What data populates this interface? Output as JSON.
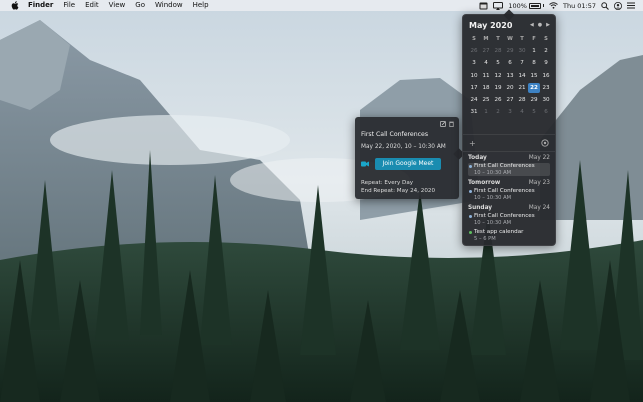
{
  "menubar": {
    "app_name": "Finder",
    "menus": [
      "File",
      "Edit",
      "View",
      "Go",
      "Window",
      "Help"
    ],
    "battery_percent": "100%",
    "clock": "Thu 01:57",
    "icons": [
      "apple-icon",
      "calendar-status-icon",
      "airplay-icon",
      "battery-icon",
      "wifi-icon",
      "search-icon",
      "user-icon",
      "list-icon"
    ]
  },
  "calendar": {
    "month_title": "May 2020",
    "weekdays": [
      "S",
      "M",
      "T",
      "W",
      "T",
      "F",
      "S"
    ],
    "weeks": [
      [
        {
          "d": "26",
          "dim": true
        },
        {
          "d": "27",
          "dim": true
        },
        {
          "d": "28",
          "dim": true
        },
        {
          "d": "29",
          "dim": true
        },
        {
          "d": "30",
          "dim": true
        },
        {
          "d": "1"
        },
        {
          "d": "2"
        }
      ],
      [
        {
          "d": "3"
        },
        {
          "d": "4"
        },
        {
          "d": "5"
        },
        {
          "d": "6"
        },
        {
          "d": "7"
        },
        {
          "d": "8"
        },
        {
          "d": "9"
        }
      ],
      [
        {
          "d": "10"
        },
        {
          "d": "11"
        },
        {
          "d": "12"
        },
        {
          "d": "13"
        },
        {
          "d": "14"
        },
        {
          "d": "15"
        },
        {
          "d": "16"
        }
      ],
      [
        {
          "d": "17"
        },
        {
          "d": "18"
        },
        {
          "d": "19"
        },
        {
          "d": "20"
        },
        {
          "d": "21"
        },
        {
          "d": "22",
          "today": true
        },
        {
          "d": "23"
        }
      ],
      [
        {
          "d": "24"
        },
        {
          "d": "25"
        },
        {
          "d": "26"
        },
        {
          "d": "27"
        },
        {
          "d": "28"
        },
        {
          "d": "29"
        },
        {
          "d": "30"
        }
      ],
      [
        {
          "d": "31"
        },
        {
          "d": "1",
          "dim": true
        },
        {
          "d": "2",
          "dim": true
        },
        {
          "d": "3",
          "dim": true
        },
        {
          "d": "4",
          "dim": true
        },
        {
          "d": "5",
          "dim": true
        },
        {
          "d": "6",
          "dim": true
        }
      ]
    ],
    "add_symbol": "+",
    "agenda": [
      {
        "day": "Today",
        "date": "May 22",
        "events": [
          {
            "title": "First Call Conferences",
            "time": "10 – 10:30 AM",
            "color": "#8fb3d9",
            "selected": true
          }
        ]
      },
      {
        "day": "Tomorrow",
        "date": "May 23",
        "events": [
          {
            "title": "First Call Conferences",
            "time": "10 – 10:30 AM",
            "color": "#8fb3d9"
          }
        ]
      },
      {
        "day": "Sunday",
        "date": "May 24",
        "events": [
          {
            "title": "First Call Conferences",
            "time": "10 – 10:30 AM",
            "color": "#8fb3d9"
          },
          {
            "title": "Test app calendar",
            "time": "5 – 6 PM",
            "color": "#5fbf5f"
          }
        ]
      }
    ]
  },
  "detail": {
    "title": "First Call Conferences",
    "when": "May 22, 2020, 10 – 10:30 AM",
    "meet_button": "Join Google Meet",
    "repeat": "Repeat: Every Day",
    "end_repeat": "End Repeat: May 24, 2020",
    "accent": "#1a8cb0"
  }
}
